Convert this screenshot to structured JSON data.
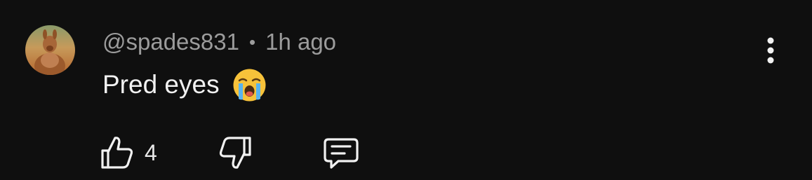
{
  "comment": {
    "author": "@spades831",
    "separator": "•",
    "timestamp": "1h ago",
    "text": "Pred eyes",
    "emoji": "loudly-crying-face",
    "like_count": "4"
  },
  "icons": {
    "more": "vertical-ellipsis-icon",
    "like": "thumbs-up-icon",
    "dislike": "thumbs-down-icon",
    "reply": "comment-icon"
  },
  "colors": {
    "background": "#0f0f0f",
    "meta_text": "#9c9c9c",
    "body_text": "#f1f1f1",
    "icon": "#f1f1f1"
  }
}
